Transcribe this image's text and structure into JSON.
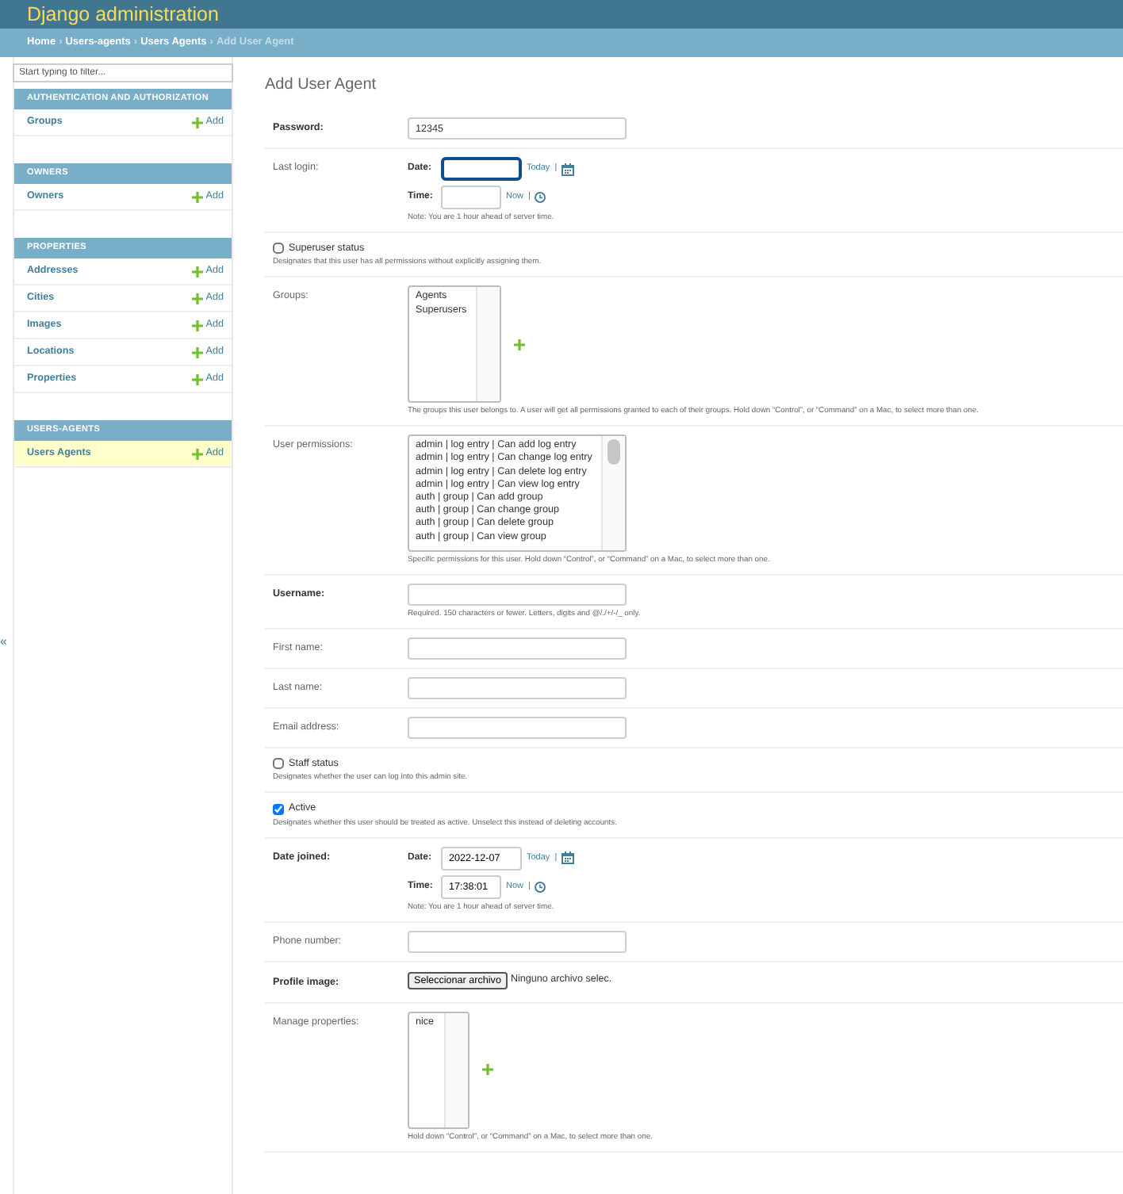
{
  "header": {
    "title": "Django administration"
  },
  "breadcrumbs": [
    {
      "label": "Home",
      "current": false
    },
    {
      "label": "Users-agents",
      "current": false
    },
    {
      "label": "Users Agents",
      "current": false
    },
    {
      "label": "Add User Agent",
      "current": true
    }
  ],
  "breadcrumb_separators": [
    "›",
    "›",
    "›"
  ],
  "sidebar": {
    "filter_placeholder": "Start typing to filter...",
    "sections": [
      {
        "title": "AUTHENTICATION AND AUTHORIZATION",
        "models": [
          {
            "name": "Groups",
            "add": "Add",
            "selected": false
          }
        ]
      },
      {
        "title": "OWNERS",
        "models": [
          {
            "name": "Owners",
            "add": "Add",
            "selected": false
          }
        ]
      },
      {
        "title": "PROPERTIES",
        "models": [
          {
            "name": "Addresses",
            "add": "Add",
            "selected": false
          },
          {
            "name": "Cities",
            "add": "Add",
            "selected": false
          },
          {
            "name": "Images",
            "add": "Add",
            "selected": false
          },
          {
            "name": "Locations",
            "add": "Add",
            "selected": false
          },
          {
            "name": "Properties",
            "add": "Add",
            "selected": false
          }
        ]
      },
      {
        "title": "USERS-AGENTS",
        "models": [
          {
            "name": "Users Agents",
            "add": "Add",
            "selected": true
          }
        ]
      }
    ],
    "toggle": "«"
  },
  "page_title": "Add User Agent",
  "fields": [
    {
      "kind": "text",
      "label": "Password:",
      "required": true,
      "value": "12345"
    },
    {
      "kind": "datetime",
      "label": "Last login:",
      "required": false,
      "date_label": "Date:",
      "date_focused": true,
      "date_shortcut": "Today",
      "date_separator": "|",
      "time_label": "Time:",
      "time_shortcut": "Now",
      "time_separator": "|",
      "note": "Note: You are 1 hour ahead of server time."
    },
    {
      "kind": "checkbox",
      "label": "Superuser status",
      "checked": false,
      "help": "Designates that this user has all permissions without explicitly assigning them."
    },
    {
      "kind": "multiselect",
      "label": "Groups:",
      "required": false,
      "add_button": true,
      "options": [
        "Agents",
        "Superusers"
      ],
      "help": "The groups this user belongs to. A user will get all permissions granted to each of their groups. Hold down “Control”, or “Command” on a Mac, to select more than one."
    },
    {
      "kind": "multiselect",
      "label": "User permissions:",
      "required": false,
      "add_button": false,
      "options": [
        "admin | log entry | Can add log entry",
        "admin | log entry | Can change log entry",
        "admin | log entry | Can delete log entry",
        "admin | log entry | Can view log entry",
        "auth | group | Can add group",
        "auth | group | Can change group",
        "auth | group | Can delete group",
        "auth | group | Can view group"
      ],
      "help": "Specific permissions for this user. Hold down “Control”, or “Command” on a Mac, to select more than one."
    },
    {
      "kind": "text",
      "label": "Username:",
      "required": true,
      "help": "Required. 150 characters or fewer. Letters, digits and @/./+/-/_ only."
    },
    {
      "kind": "text",
      "label": "First name:",
      "required": false
    },
    {
      "kind": "text",
      "label": "Last name:",
      "required": false
    },
    {
      "kind": "text",
      "label": "Email address:",
      "required": false
    },
    {
      "kind": "checkbox",
      "label": "Staff status",
      "checked": false,
      "help": "Designates whether the user can log into this admin site."
    },
    {
      "kind": "checkbox",
      "label": "Active",
      "checked": true,
      "help": "Designates whether this user should be treated as active. Unselect this instead of deleting accounts."
    },
    {
      "kind": "datetime",
      "label": "Date joined:",
      "required": true,
      "date_label": "Date:",
      "date_value": "2022-12-07",
      "date_focused": false,
      "date_shortcut": "Today",
      "date_separator": "|",
      "time_label": "Time:",
      "time_value": "17:38:01",
      "time_shortcut": "Now",
      "time_separator": "|",
      "note": "Note: You are 1 hour ahead of server time."
    },
    {
      "kind": "text",
      "label": "Phone number:",
      "required": false
    },
    {
      "kind": "file",
      "label": "Profile image:",
      "required": true,
      "button": "Seleccionar archivo",
      "status": "Ninguno archivo selec."
    },
    {
      "kind": "multiselect",
      "label": "Manage properties:",
      "required": false,
      "add_button": true,
      "options": [
        "nice"
      ],
      "help": "Hold down “Control”, or “Command” on a Mac, to select more than one."
    }
  ]
}
